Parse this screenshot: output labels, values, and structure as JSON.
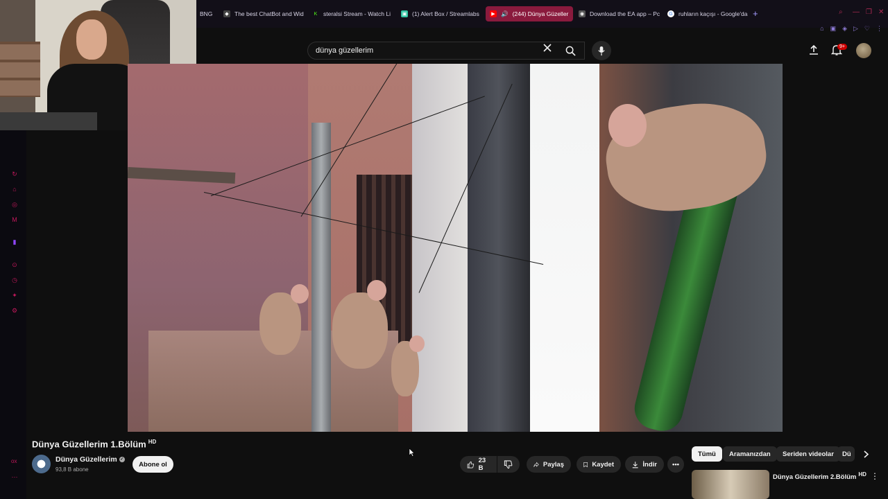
{
  "browser": {
    "tabs": [
      {
        "label": "BNG",
        "color": "#d8d4e6",
        "icon": "text-icon"
      },
      {
        "label": "The best ChatBot and Wid",
        "color": "#d8d4e6",
        "icon": "bot-icon"
      },
      {
        "label": "steralsi Stream - Watch Li",
        "color": "#53fc18",
        "icon": "kick-icon"
      },
      {
        "label": "(1) Alert Box / Streamlabs",
        "color": "#31c3a2",
        "icon": "streamlabs-icon"
      },
      {
        "label": "(244) Dünya Güzeller",
        "color": "#ff0000",
        "icon": "youtube-icon",
        "active": true
      },
      {
        "label": "Download the EA app – Pc",
        "color": "#d8d4e6",
        "icon": "ea-icon"
      },
      {
        "label": "ruhların kaçışı - Google'da",
        "color": "#d8d4e6",
        "icon": "google-icon"
      }
    ],
    "accent": "#8a1a3d"
  },
  "search": {
    "query": "dünya güzellerim"
  },
  "header": {
    "notification_count": "9+"
  },
  "video": {
    "title": "Dünya Güzellerim 1.Bölüm",
    "quality_badge": "HD",
    "channel_name": "Dünya Güzellerim",
    "subscribers": "93,8 B abone",
    "subscribe_label": "Abone ol",
    "likes": "23 B",
    "share_label": "Paylaş",
    "save_label": "Kaydet",
    "download_label": "İndir"
  },
  "chips": [
    "Tümü",
    "Aramanızdan",
    "Seriden videolar",
    "Dü"
  ],
  "recommended": [
    {
      "title": "Dünya Güzellerim 2.Bölüm",
      "quality_badge": "HD"
    }
  ],
  "sidebar_text": "ox"
}
